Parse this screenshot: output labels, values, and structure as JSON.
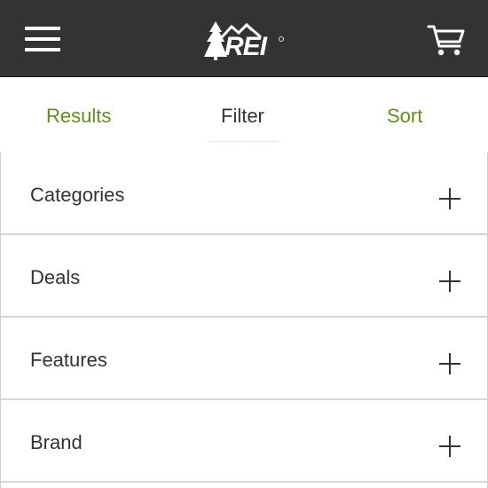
{
  "header": {
    "menu_icon": "hamburger-menu-icon",
    "logo_text": "REI",
    "cart_icon": "shopping-cart-icon",
    "background_color": "#333333"
  },
  "tabs": {
    "results_label": "Results",
    "filter_label": "Filter",
    "sort_label": "Sort",
    "active": "Filter",
    "accent_color": "#5f8f1a"
  },
  "filters": {
    "items": [
      {
        "label": "Categories",
        "icon": "plus-icon"
      },
      {
        "label": "Deals",
        "icon": "plus-icon"
      },
      {
        "label": "Features",
        "icon": "plus-icon"
      },
      {
        "label": "Brand",
        "icon": "plus-icon"
      }
    ]
  }
}
